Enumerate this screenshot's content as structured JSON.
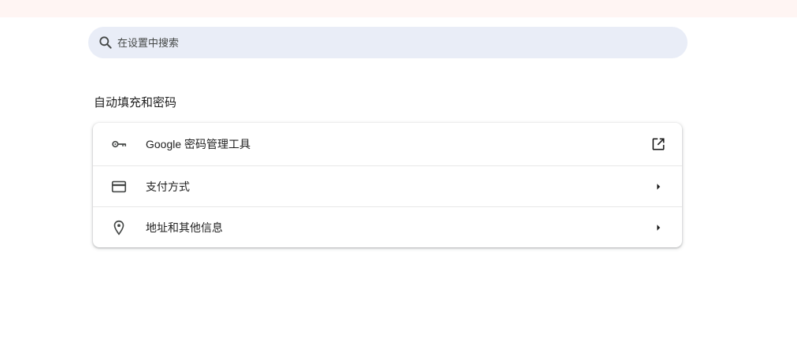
{
  "search": {
    "placeholder": "在设置中搜索",
    "icon": "search-icon"
  },
  "autofill": {
    "title": "自动填充和密码",
    "items": [
      {
        "label": "Google 密码管理工具",
        "icon": "key-icon",
        "action_icon": "open-in-new-icon"
      },
      {
        "label": "支付方式",
        "icon": "credit-card-icon",
        "action_icon": "arrow-right-icon"
      },
      {
        "label": "地址和其他信息",
        "icon": "location-pin-icon",
        "action_icon": "arrow-right-icon"
      }
    ]
  },
  "colors": {
    "search_bg": "#e9edf7",
    "icon": "#444746",
    "text": "#1f1f1f",
    "top_strip": "#fff5f3"
  }
}
